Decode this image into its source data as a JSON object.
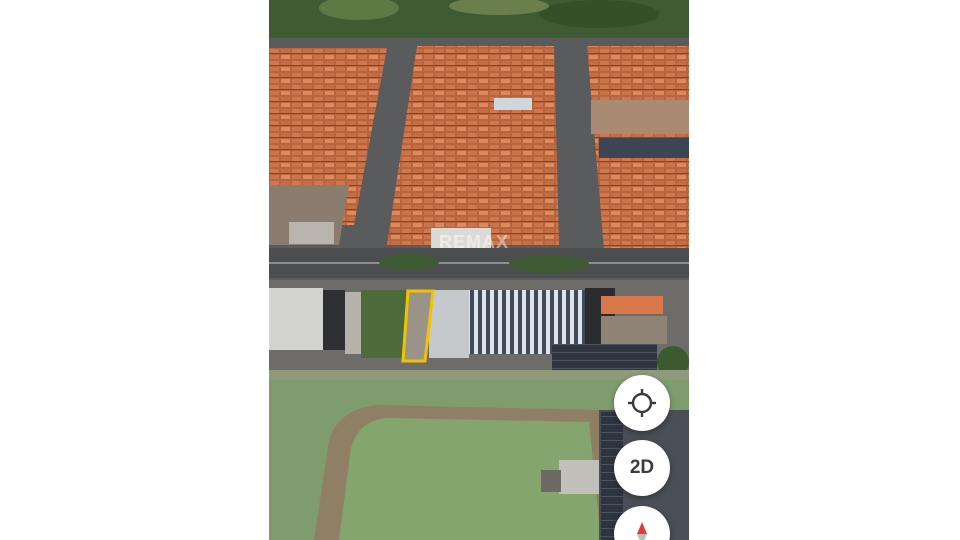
{
  "map": {
    "view_mode": "satellite-3d",
    "highlight_color": "#f2c200",
    "watermark_text": "REMAX"
  },
  "controls": {
    "locate_icon": "crosshair-icon",
    "toggle_2d_label": "2D",
    "compass_icon": "compass-icon"
  }
}
